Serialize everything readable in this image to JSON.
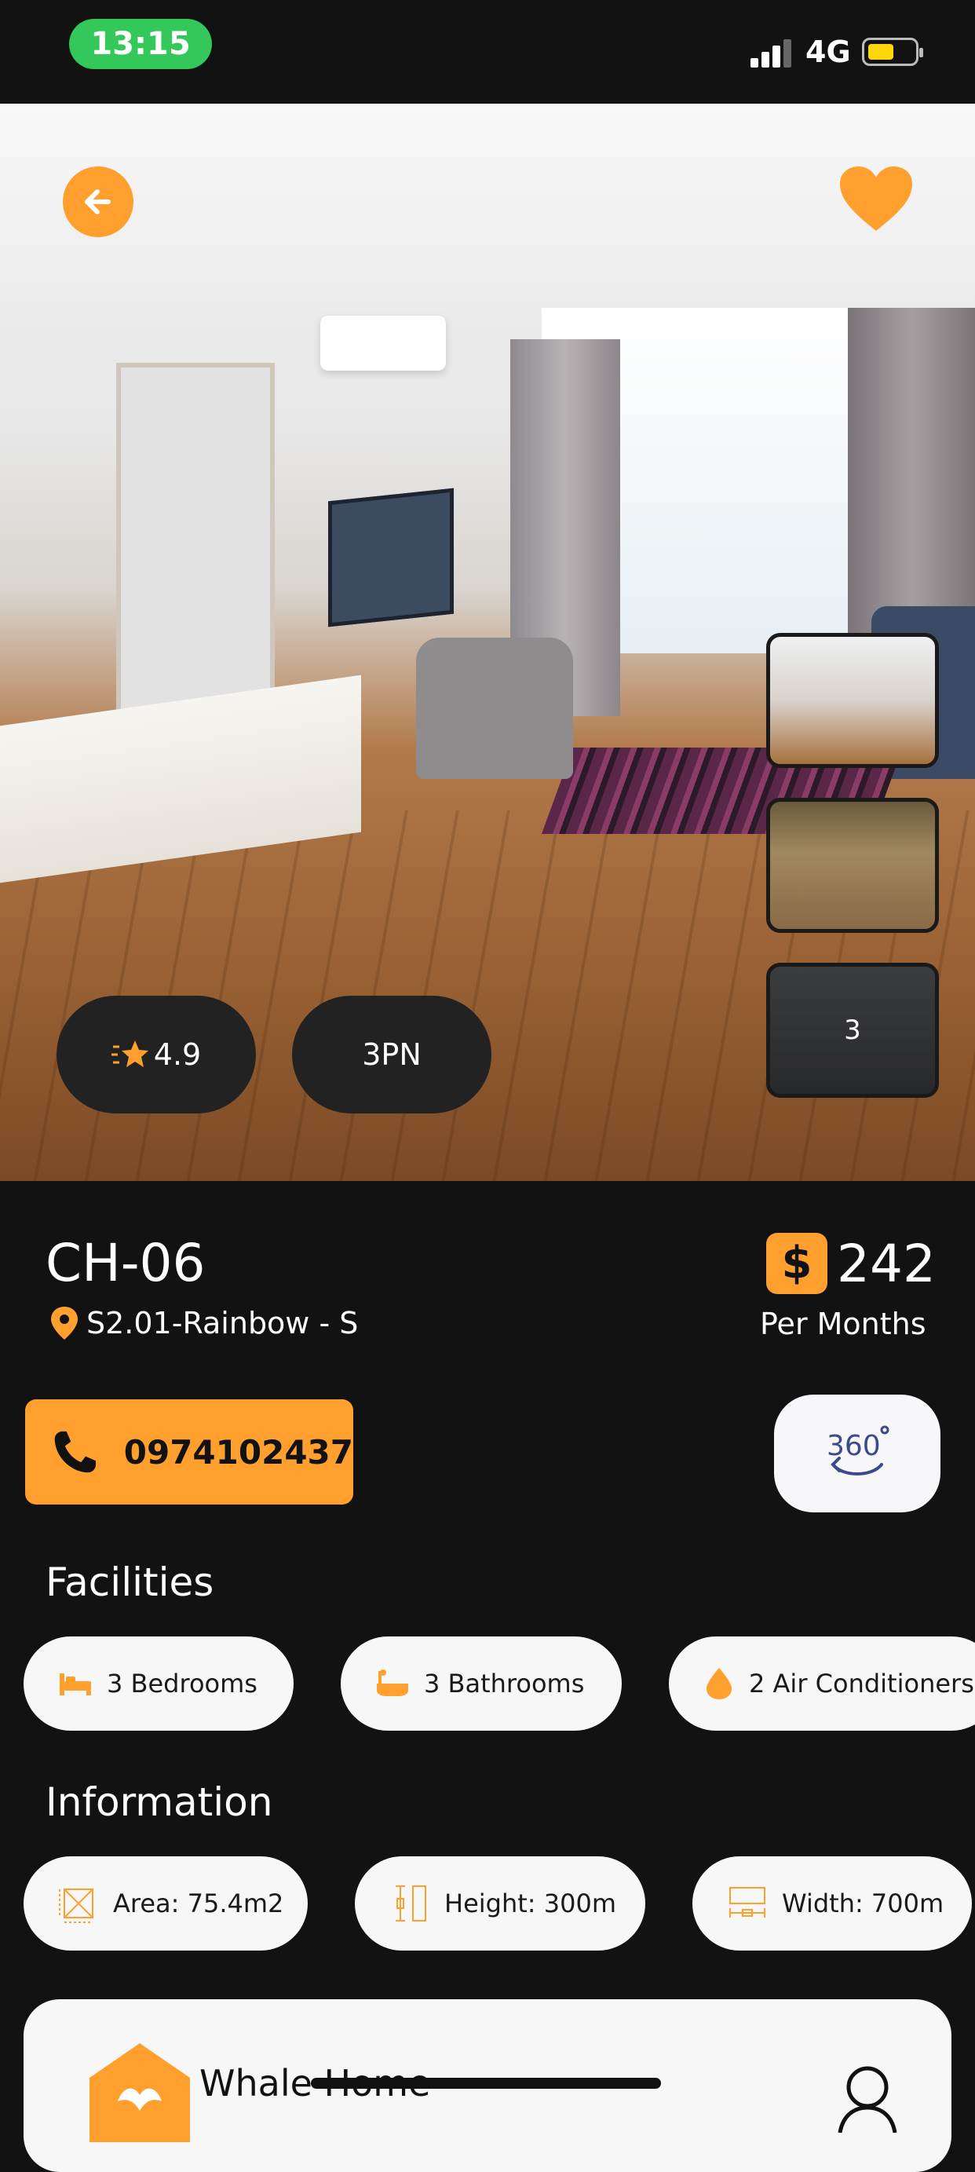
{
  "status": {
    "time": "13:15",
    "network": "4G"
  },
  "hero": {
    "rating": "4.9",
    "rooms": "3PN",
    "more_photos": "3",
    "colors": {
      "accent": "#FFA02E"
    }
  },
  "listing": {
    "code": "CH-06",
    "address": "S2.01-Rainbow - S",
    "currency_symbol": "$",
    "price": "242",
    "price_period": "Per Months",
    "phone": "0974102437"
  },
  "facilities": {
    "title": "Facilities",
    "items": [
      {
        "icon": "bed-icon",
        "label": "3 Bedrooms"
      },
      {
        "icon": "bathtub-icon",
        "label": "3 Bathrooms"
      },
      {
        "icon": "droplet-icon",
        "label": "2 Air Conditioners"
      }
    ]
  },
  "information": {
    "title": "Information",
    "items": [
      {
        "icon": "area-icon",
        "label": "Area: 75.4m2"
      },
      {
        "icon": "height-icon",
        "label": "Height: 300m"
      },
      {
        "icon": "width-icon",
        "label": "Width: 700m"
      }
    ]
  },
  "agent": {
    "name": "Whale Home"
  }
}
